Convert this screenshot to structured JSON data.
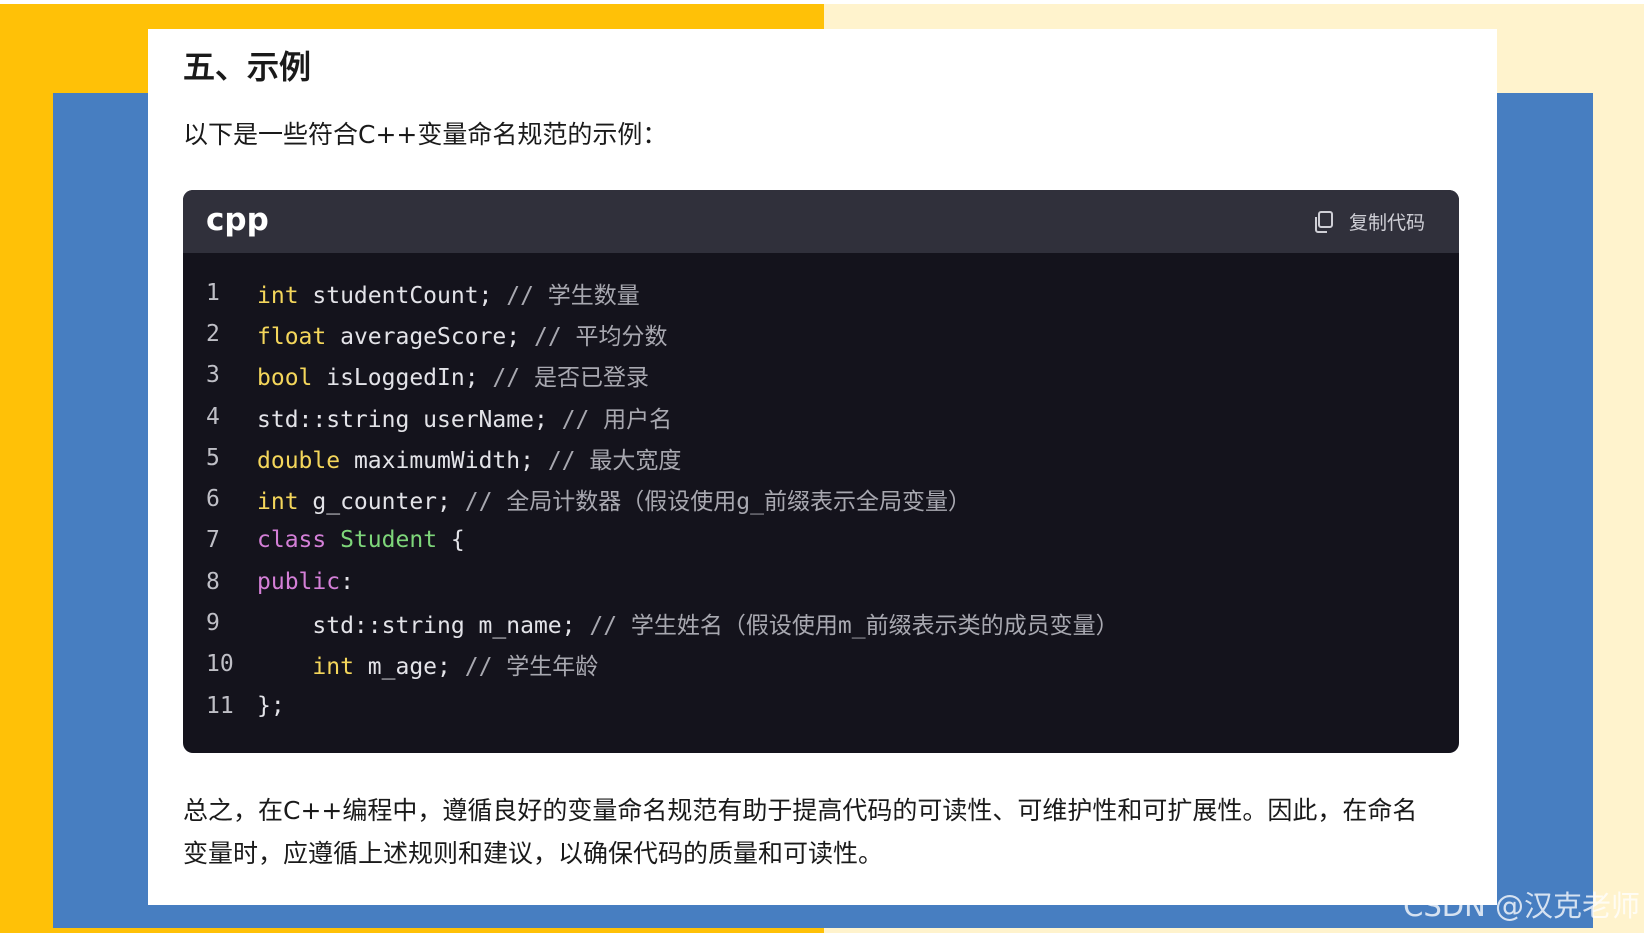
{
  "section": {
    "heading": "五、示例",
    "intro": "以下是一些符合C++变量命名规范的示例：",
    "summary": "总之，在C++编程中，遵循良好的变量命名规范有助于提高代码的可读性、可维护性和可扩展性。因此，在命名变量时，应遵循上述规则和建议，以确保代码的质量和可读性。"
  },
  "code_block": {
    "language": "cpp",
    "copy_label": "复制代码",
    "copy_icon": "copy-icon",
    "lines": [
      {
        "num": "1",
        "indent": "",
        "kw": "int",
        "kw2": "",
        "rest": " studentCount; ",
        "comment": "// 学生数量"
      },
      {
        "num": "2",
        "indent": "",
        "kw": "float",
        "kw2": "",
        "rest": " averageScore; ",
        "comment": "// 平均分数"
      },
      {
        "num": "3",
        "indent": "",
        "kw": "bool",
        "kw2": "",
        "rest": " isLoggedIn; ",
        "comment": "// 是否已登录"
      },
      {
        "num": "4",
        "indent": "",
        "kw": "",
        "kw2": "",
        "rest": "std::string userName; ",
        "comment": "// 用户名"
      },
      {
        "num": "5",
        "indent": "",
        "kw": "double",
        "kw2": "",
        "rest": " maximumWidth; ",
        "comment": "// 最大宽度"
      },
      {
        "num": "6",
        "indent": "",
        "kw": "int",
        "kw2": "",
        "rest": " g_counter; ",
        "comment": "// 全局计数器（假设使用g_前缀表示全局变量）"
      },
      {
        "num": "7",
        "class_kw": "class",
        "class_name": "Student",
        "rest": " {"
      },
      {
        "num": "8",
        "access_kw": "public",
        "rest": ":"
      },
      {
        "num": "9",
        "indent": "    ",
        "kw": "",
        "kw2": "",
        "rest": "std::string m_name; ",
        "comment": "// 学生姓名（假设使用m_前缀表示类的成员变量）"
      },
      {
        "num": "10",
        "indent": "    ",
        "kw": "int",
        "kw2": "",
        "rest": " m_age; ",
        "comment": "// 学生年龄"
      },
      {
        "num": "11",
        "indent": "",
        "kw": "",
        "kw2": "",
        "rest": "};",
        "comment": ""
      }
    ]
  },
  "watermark": "CSDN @汉克老师",
  "colors": {
    "bg_left": "#ffc107",
    "bg_right": "#fff3cd",
    "bg_frame": "#477ec1",
    "code_bg": "#14131c",
    "code_header_bg": "#30303b",
    "keyword_type": "#f4d65b",
    "keyword_class": "#d47fd7",
    "class_name": "#7ed67a"
  }
}
